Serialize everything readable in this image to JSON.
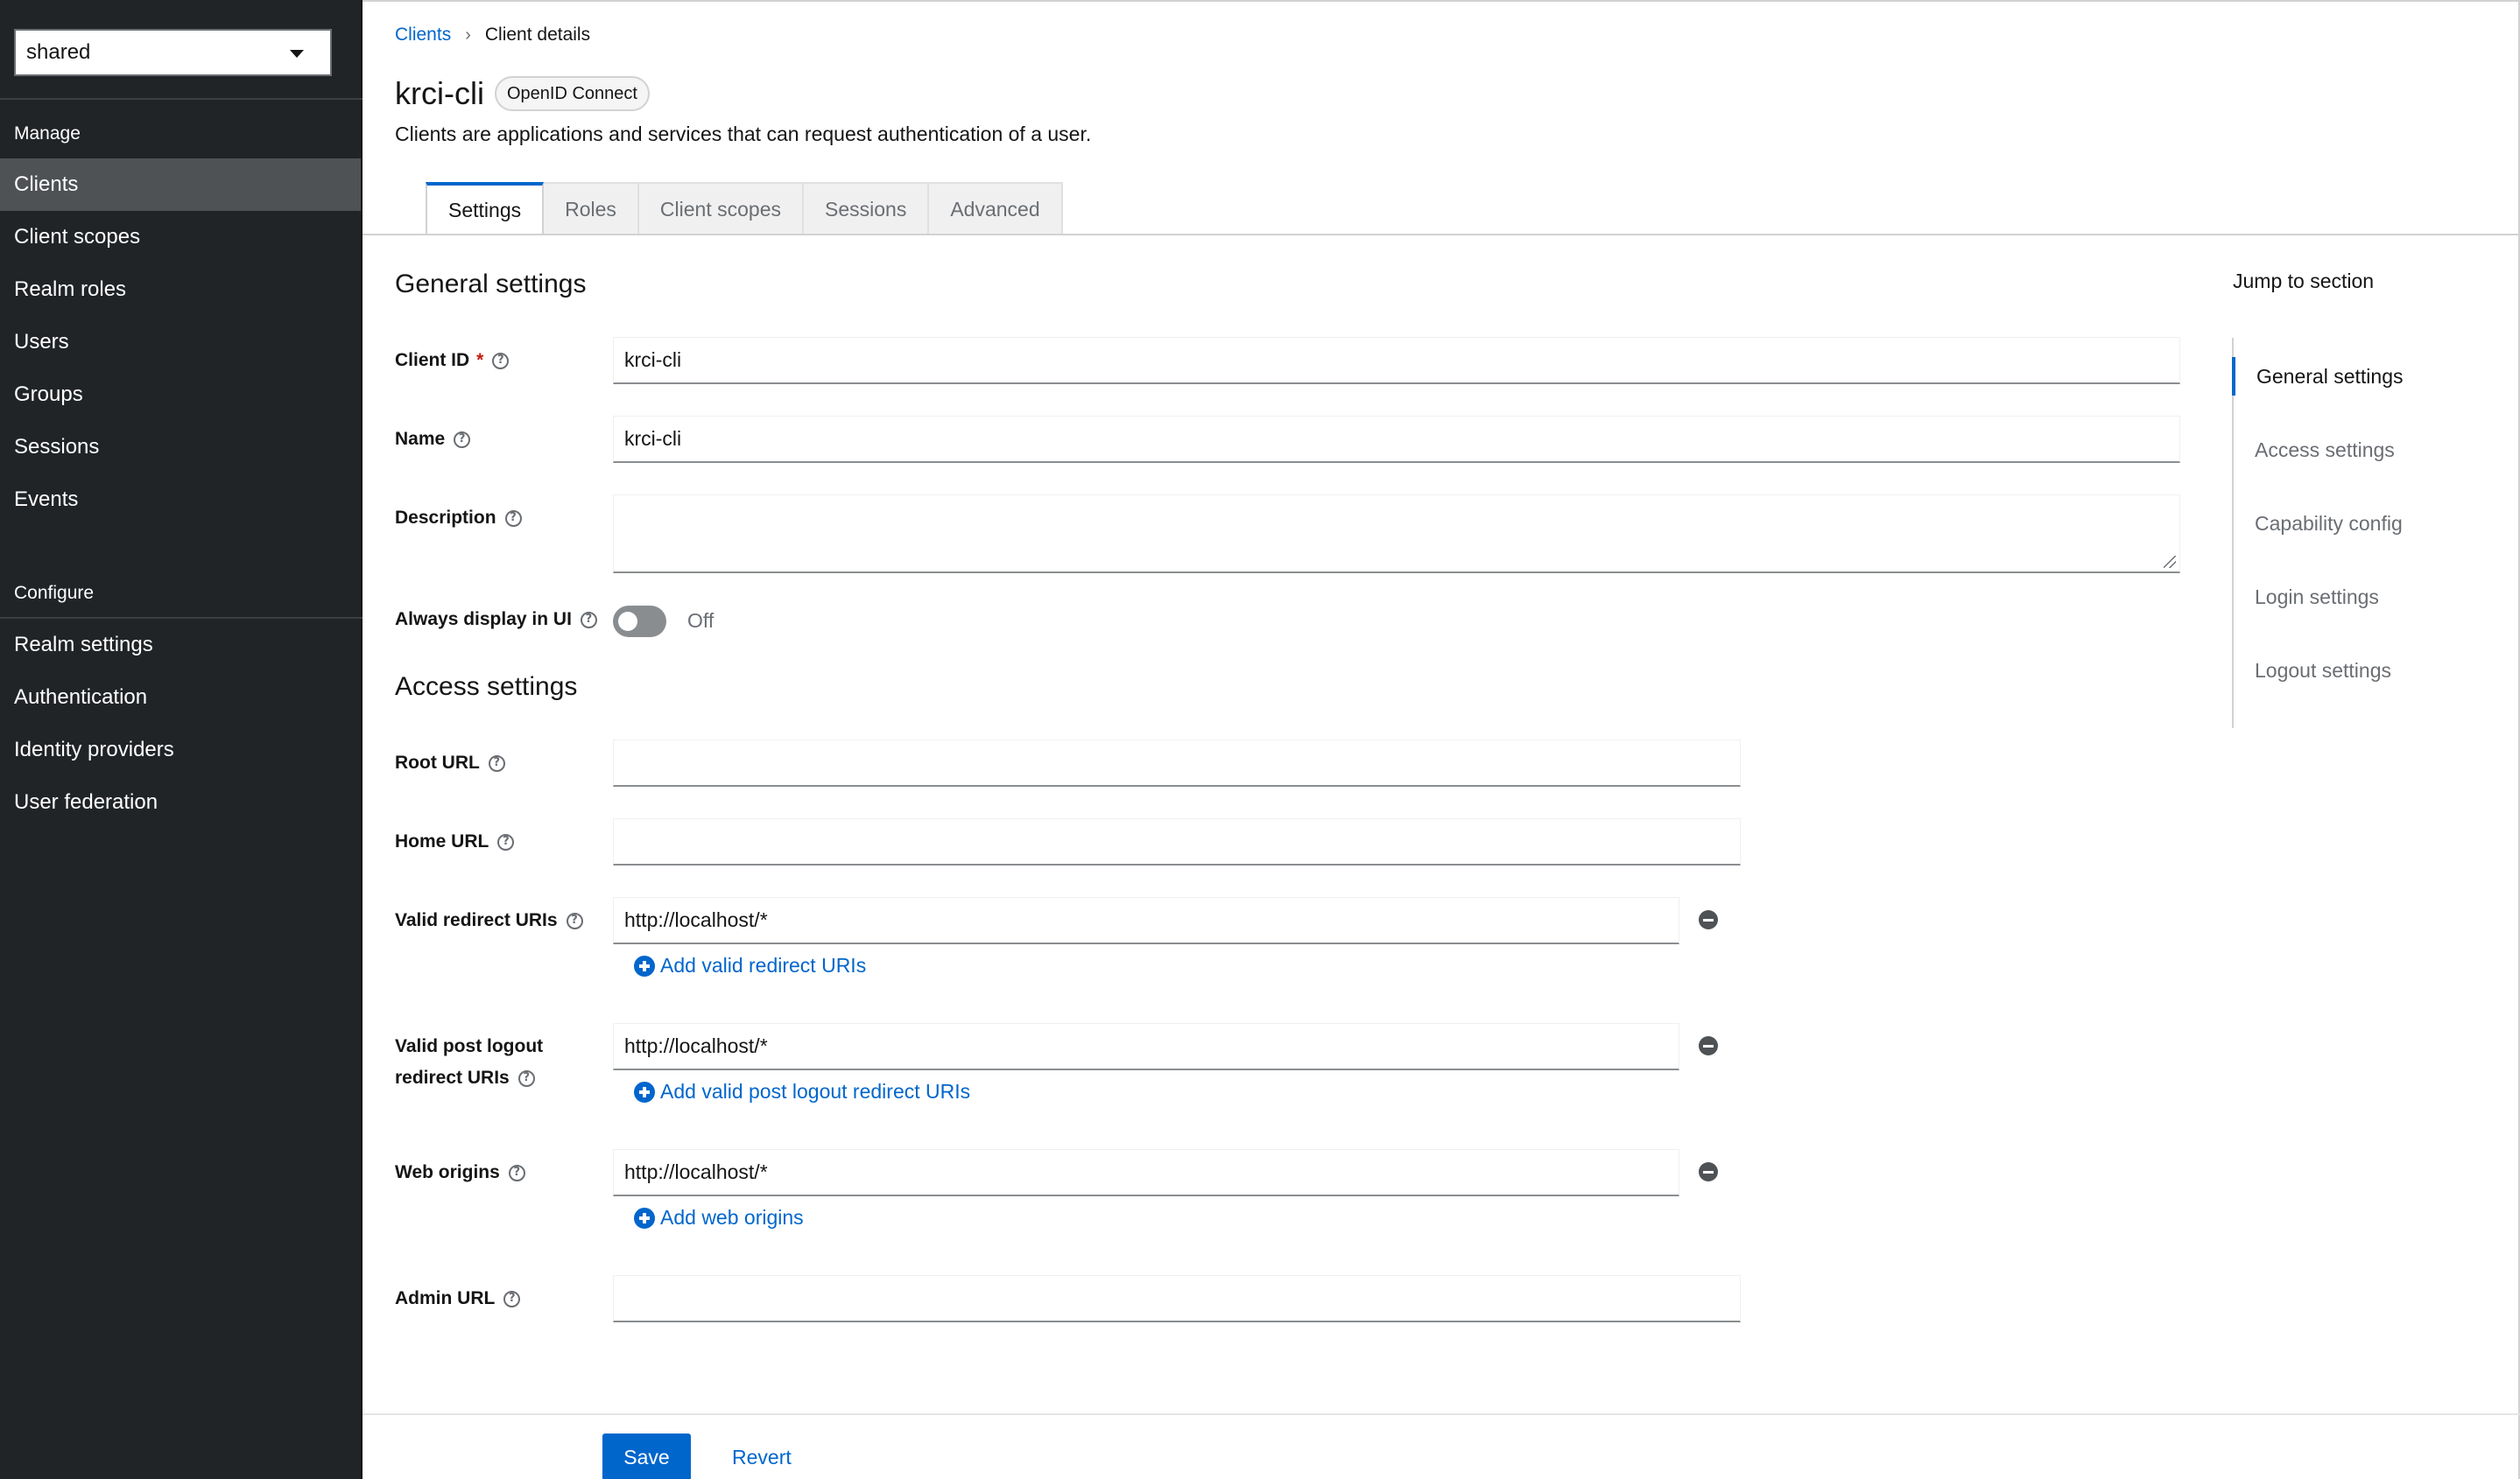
{
  "sidebar": {
    "realm": "shared",
    "manage_title": "Manage",
    "manage_items": [
      "Clients",
      "Client scopes",
      "Realm roles",
      "Users",
      "Groups",
      "Sessions",
      "Events"
    ],
    "configure_title": "Configure",
    "configure_items": [
      "Realm settings",
      "Authentication",
      "Identity providers",
      "User federation"
    ],
    "active_item": "Clients"
  },
  "breadcrumb": {
    "parent": "Clients",
    "current": "Client details",
    "separator": "›"
  },
  "header": {
    "title": "krci-cli",
    "badge": "OpenID Connect",
    "subtitle": "Clients are applications and services that can request authentication of a user."
  },
  "tabs": [
    "Settings",
    "Roles",
    "Client scopes",
    "Sessions",
    "Advanced"
  ],
  "general": {
    "title": "General settings",
    "client_id_label": "Client ID",
    "client_id_required": "*",
    "client_id_value": "krci-cli",
    "name_label": "Name",
    "name_value": "krci-cli",
    "description_label": "Description",
    "description_value": "",
    "always_display_label": "Always display in UI",
    "always_display_state": "Off"
  },
  "access": {
    "title": "Access settings",
    "root_url_label": "Root URL",
    "root_url_value": "",
    "home_url_label": "Home URL",
    "home_url_value": "",
    "redirect_label": "Valid redirect URIs",
    "redirect_value": "http://localhost/*",
    "redirect_add": "Add valid redirect URIs",
    "post_logout_label_1": "Valid post logout",
    "post_logout_label_2": "redirect URIs",
    "post_logout_value": "http://localhost/*",
    "post_logout_add": "Add valid post logout redirect URIs",
    "web_origins_label": "Web origins",
    "web_origins_value": "http://localhost/*",
    "web_origins_add": "Add web origins",
    "admin_url_label": "Admin URL",
    "admin_url_value": ""
  },
  "jump": {
    "title": "Jump to section",
    "items": [
      "General settings",
      "Access settings",
      "Capability config",
      "Login settings",
      "Logout settings"
    ]
  },
  "footer": {
    "save": "Save",
    "revert": "Revert"
  },
  "icons": {
    "help": "help-circle-icon",
    "remove": "minus-circle-icon",
    "add": "plus-circle-icon",
    "caret": "caret-down-icon"
  },
  "colors": {
    "accent": "#0066cc",
    "sidebar_bg": "#212427",
    "sidebar_active": "#4f5255",
    "required": "#c9190b"
  }
}
